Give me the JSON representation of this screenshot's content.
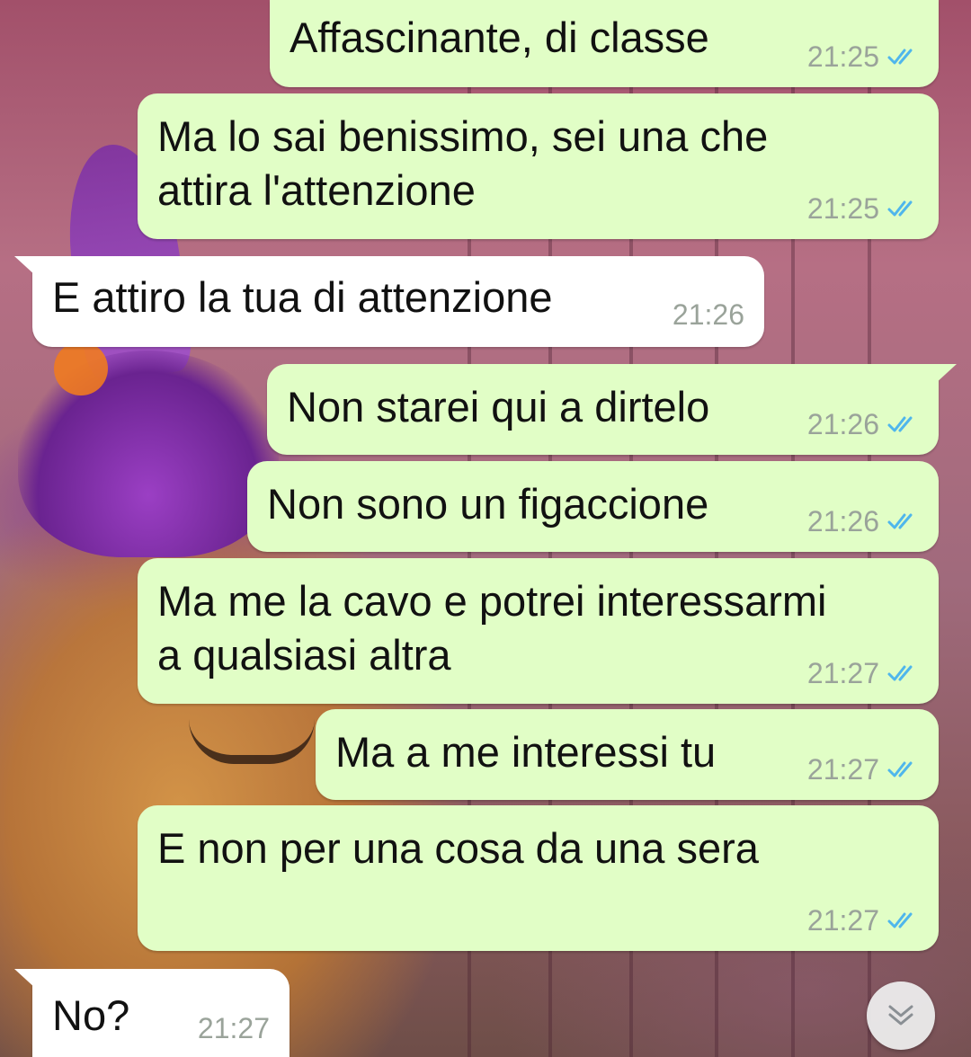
{
  "chat": {
    "messages": [
      {
        "direction": "out",
        "text": "Affascinante, di classe",
        "time": "21:25",
        "status": "read"
      },
      {
        "direction": "out",
        "lines": [
          "Ma lo sai benissimo, sei una che",
          "attira l'attenzione"
        ],
        "time": "21:25",
        "status": "read"
      },
      {
        "direction": "in",
        "text": "E attiro la tua di attenzione",
        "time": "21:26"
      },
      {
        "direction": "out",
        "text": "Non starei qui a dirtelo",
        "time": "21:26",
        "status": "read"
      },
      {
        "direction": "out",
        "text": "Non sono un figaccione",
        "time": "21:26",
        "status": "read"
      },
      {
        "direction": "out",
        "lines": [
          "Ma me la cavo e potrei interessarmi",
          "a qualsiasi altra"
        ],
        "time": "21:27",
        "status": "read"
      },
      {
        "direction": "out",
        "text": "Ma a me interessi tu",
        "time": "21:27",
        "status": "read"
      },
      {
        "direction": "out",
        "text": "E non per una cosa da una sera",
        "time": "21:27",
        "status": "read"
      },
      {
        "direction": "in",
        "text": "No?",
        "time": "21:27"
      }
    ]
  },
  "colors": {
    "outgoing_bubble": "#e1fec6",
    "incoming_bubble": "#ffffff",
    "read_ticks": "#4fb6ec",
    "timestamp": "#9aa39a"
  },
  "icons": {
    "read_receipt": "double-check-icon",
    "scroll_down": "chevron-double-down-icon"
  }
}
